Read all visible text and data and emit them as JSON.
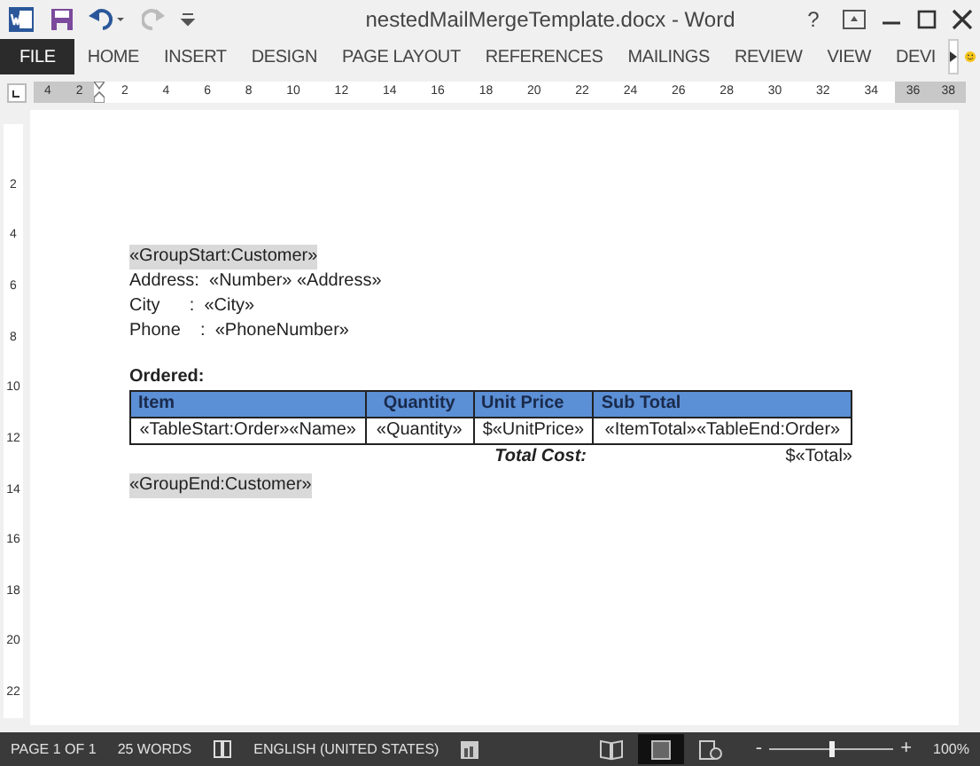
{
  "window": {
    "title": "nestedMailMergeTemplate.docx - Word",
    "help": "?"
  },
  "ribbon_tabs": [
    {
      "label": "FILE",
      "selected": true
    },
    {
      "label": "HOME",
      "selected": false
    },
    {
      "label": "INSERT",
      "selected": false
    },
    {
      "label": "DESIGN",
      "selected": false
    },
    {
      "label": "PAGE LAYOUT",
      "selected": false
    },
    {
      "label": "REFERENCES",
      "selected": false
    },
    {
      "label": "MAILINGS",
      "selected": false
    },
    {
      "label": "REVIEW",
      "selected": false
    },
    {
      "label": "VIEW",
      "selected": false
    },
    {
      "label": "DEVI",
      "selected": false
    }
  ],
  "ruler": {
    "left_numbers": [
      "4",
      "2"
    ],
    "numbers": [
      "2",
      "4",
      "6",
      "8",
      "10",
      "12",
      "14",
      "16",
      "18",
      "20",
      "22",
      "24",
      "26",
      "28",
      "30",
      "32",
      "34"
    ],
    "right_numbers": [
      "36",
      "38"
    ],
    "vertical_numbers": [
      "2",
      "4",
      "6",
      "8",
      "10",
      "12",
      "14",
      "16",
      "18",
      "20",
      "22"
    ]
  },
  "document": {
    "lines": [
      {
        "kind": "highlighted",
        "text": "«GroupStart:Customer»"
      },
      {
        "kind": "text",
        "text": "Address:  «Number» «Address»"
      },
      {
        "kind": "text",
        "text": "City      :  «City»"
      },
      {
        "kind": "text",
        "text": "Phone    :  «PhoneNumber»"
      },
      {
        "kind": "blank"
      },
      {
        "kind": "bold",
        "text": "Ordered:"
      }
    ],
    "table": {
      "columns": [
        "Item",
        "Quantity",
        "Unit Price",
        "Sub Total"
      ],
      "rows": [
        [
          "«TableStart:Order»«Name»",
          "«Quantity»",
          "$«UnitPrice»",
          "«ItemTotal»«TableEnd:Order»"
        ]
      ],
      "total_label": "Total Cost:",
      "total_value": "$«Total»"
    },
    "end_line": {
      "kind": "highlighted",
      "text": "«GroupEnd:Customer»"
    }
  },
  "status_bar": {
    "page": "PAGE 1 OF 1",
    "words": "25 WORDS",
    "language": "ENGLISH (UNITED STATES)",
    "views": [
      {
        "kind": "read",
        "selected": false
      },
      {
        "kind": "print",
        "selected": true
      },
      {
        "kind": "web",
        "selected": false
      }
    ],
    "zoom_out": "-",
    "zoom_in": "+",
    "zoom": {
      "level": 0.5
    },
    "zoom_text": "100%"
  }
}
